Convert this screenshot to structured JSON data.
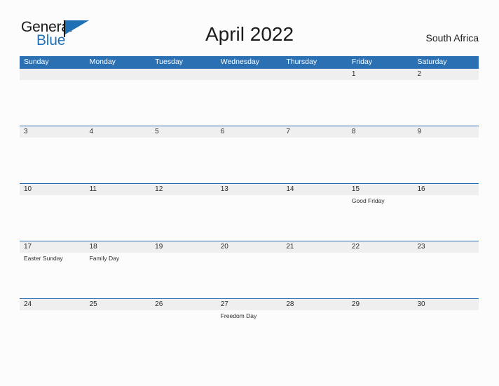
{
  "logo": {
    "word_top": "General",
    "word_bottom": "Blue",
    "flag_icon": "triangle-flag-icon"
  },
  "header": {
    "title": "April 2022",
    "country": "South Africa"
  },
  "colors": {
    "header_blue": "#2b70b3",
    "date_band_gray": "#efefef",
    "logo_blue": "#2272b8",
    "page_background": "#fcfcfc",
    "text": "#2a2a2a"
  },
  "calendar": {
    "weekdays": [
      "Sunday",
      "Monday",
      "Tuesday",
      "Wednesday",
      "Thursday",
      "Friday",
      "Saturday"
    ],
    "weeks": [
      {
        "days": [
          {
            "date": "",
            "event": ""
          },
          {
            "date": "",
            "event": ""
          },
          {
            "date": "",
            "event": ""
          },
          {
            "date": "",
            "event": ""
          },
          {
            "date": "",
            "event": ""
          },
          {
            "date": "1",
            "event": ""
          },
          {
            "date": "2",
            "event": ""
          }
        ]
      },
      {
        "days": [
          {
            "date": "3",
            "event": ""
          },
          {
            "date": "4",
            "event": ""
          },
          {
            "date": "5",
            "event": ""
          },
          {
            "date": "6",
            "event": ""
          },
          {
            "date": "7",
            "event": ""
          },
          {
            "date": "8",
            "event": ""
          },
          {
            "date": "9",
            "event": ""
          }
        ]
      },
      {
        "days": [
          {
            "date": "10",
            "event": ""
          },
          {
            "date": "11",
            "event": ""
          },
          {
            "date": "12",
            "event": ""
          },
          {
            "date": "13",
            "event": ""
          },
          {
            "date": "14",
            "event": ""
          },
          {
            "date": "15",
            "event": "Good Friday"
          },
          {
            "date": "16",
            "event": ""
          }
        ]
      },
      {
        "days": [
          {
            "date": "17",
            "event": "Easter Sunday"
          },
          {
            "date": "18",
            "event": "Family Day"
          },
          {
            "date": "19",
            "event": ""
          },
          {
            "date": "20",
            "event": ""
          },
          {
            "date": "21",
            "event": ""
          },
          {
            "date": "22",
            "event": ""
          },
          {
            "date": "23",
            "event": ""
          }
        ]
      },
      {
        "days": [
          {
            "date": "24",
            "event": ""
          },
          {
            "date": "25",
            "event": ""
          },
          {
            "date": "26",
            "event": ""
          },
          {
            "date": "27",
            "event": "Freedom Day"
          },
          {
            "date": "28",
            "event": ""
          },
          {
            "date": "29",
            "event": ""
          },
          {
            "date": "30",
            "event": ""
          }
        ]
      }
    ]
  }
}
